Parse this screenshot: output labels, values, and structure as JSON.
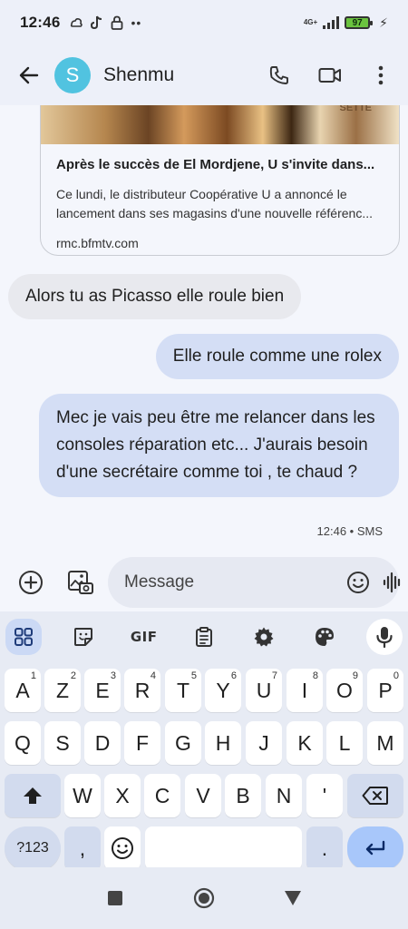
{
  "status_bar": {
    "time": "12:46",
    "network": "4G+",
    "battery": "97"
  },
  "header": {
    "avatar_letter": "S",
    "contact_name": "Shenmu"
  },
  "link_preview": {
    "image_text": "SETTE",
    "title": "Après le succès de El Mordjene, U s'invite dans...",
    "description": "Ce lundi, le distributeur Coopérative U a annoncé le lancement dans ses magasins d'une nouvelle référenc...",
    "domain": "rmc.bfmtv.com"
  },
  "messages": [
    {
      "direction": "in",
      "text": "Alors tu as Picasso elle roule bien"
    },
    {
      "direction": "out",
      "text": "Elle roule comme une rolex"
    },
    {
      "direction": "out",
      "text": "Mec je vais peu être me relancer dans les consoles réparation etc... J'aurais besoin d'une secrétaire comme toi , te chaud ?"
    }
  ],
  "last_message_meta": "12:46 • SMS",
  "composer": {
    "placeholder": "Message"
  },
  "keyboard": {
    "toolbar": {
      "gif_label": "GIF"
    },
    "row1": [
      {
        "label": "A",
        "hint": "1"
      },
      {
        "label": "Z",
        "hint": "2"
      },
      {
        "label": "E",
        "hint": "3"
      },
      {
        "label": "R",
        "hint": "4"
      },
      {
        "label": "T",
        "hint": "5"
      },
      {
        "label": "Y",
        "hint": "6"
      },
      {
        "label": "U",
        "hint": "7"
      },
      {
        "label": "I",
        "hint": "8"
      },
      {
        "label": "O",
        "hint": "9"
      },
      {
        "label": "P",
        "hint": "0"
      }
    ],
    "row2": [
      "Q",
      "S",
      "D",
      "F",
      "G",
      "H",
      "J",
      "K",
      "L",
      "M"
    ],
    "row3": [
      "W",
      "X",
      "C",
      "V",
      "B",
      "N",
      "'"
    ],
    "row4": {
      "symbols": "?123",
      "comma": ",",
      "period": "."
    }
  }
}
